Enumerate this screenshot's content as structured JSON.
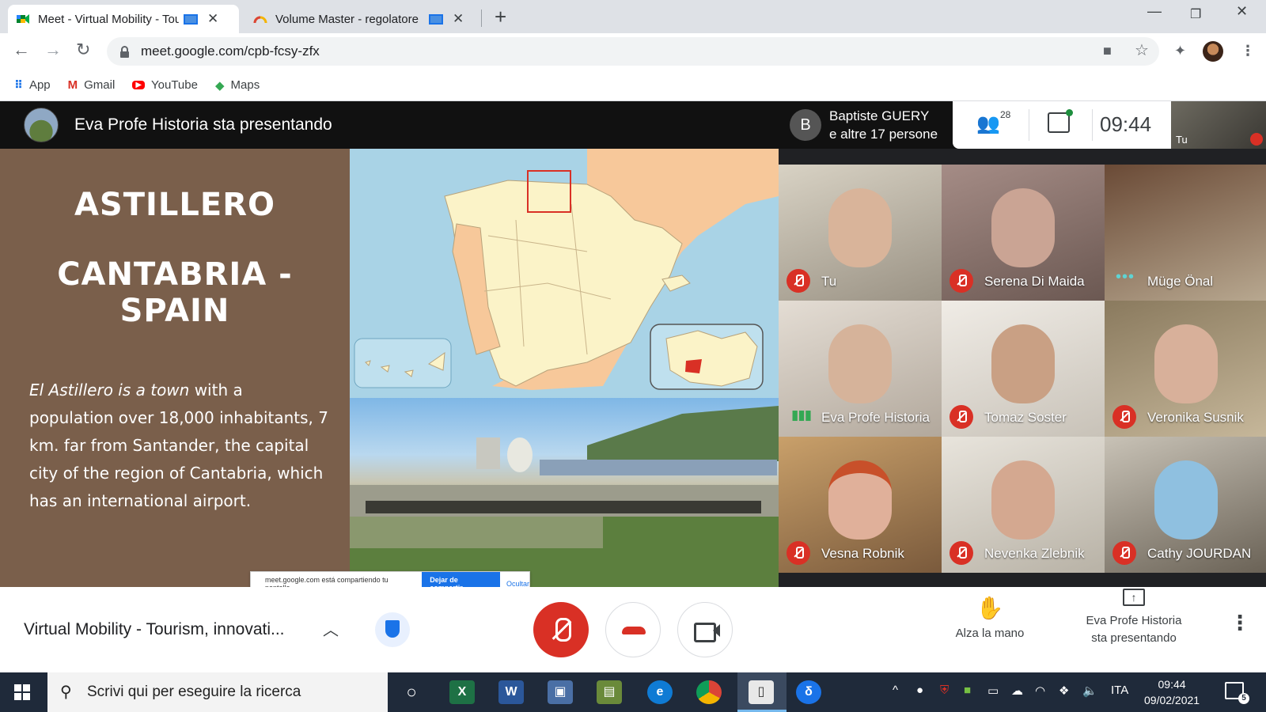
{
  "browser": {
    "tabs": [
      {
        "title": "Meet - Virtual Mobility - Tou",
        "favicon": "google-meet-icon",
        "active": true
      },
      {
        "title": "Volume Master - regolatore",
        "favicon": "volume-master-icon",
        "active": false
      }
    ],
    "url": "meet.google.com/cpb-fcsy-zfx",
    "bookmarks": [
      {
        "label": "App",
        "icon": "apps-grid-icon"
      },
      {
        "label": "Gmail",
        "icon": "gmail-icon"
      },
      {
        "label": "YouTube",
        "icon": "youtube-icon"
      },
      {
        "label": "Maps",
        "icon": "maps-icon"
      }
    ]
  },
  "meet": {
    "presenting_banner": "Eva Profe Historia sta presentando",
    "notification": {
      "avatar_letter": "B",
      "line1": "Baptiste GUERY",
      "line2": "e altre 17 persone"
    },
    "people_count": "28",
    "clock": "09:44",
    "self_label": "Tu",
    "slide": {
      "title1": "ASTILLERO",
      "title2_line1": "CANTABRIA -",
      "title2_line2": "SPAIN",
      "body_italic": "El Astillero is a town",
      "body_rest": " with a population over 18,000 inhabitants, 7 km. far from Santander, the capital city of the region of Cantabria, which has an international airport."
    },
    "share_banner": {
      "text": "meet.google.com está compartiendo tu pantalla.",
      "stop": "Dejar de compartir",
      "hide": "Ocultar"
    },
    "participants": [
      {
        "name": "Tu",
        "status": "muted"
      },
      {
        "name": "Serena Di Maida",
        "status": "muted"
      },
      {
        "name": "Müge Önal",
        "status": "dots"
      },
      {
        "name": "Eva Profe Historia",
        "status": "talking"
      },
      {
        "name": "Tomaz Soster",
        "status": "muted"
      },
      {
        "name": "Veronika Susnik",
        "status": "muted"
      },
      {
        "name": "Vesna Robnik",
        "status": "muted"
      },
      {
        "name": "Nevenka Zlebnik",
        "status": "muted"
      },
      {
        "name": "Cathy JOURDAN",
        "status": "muted"
      }
    ],
    "controls": {
      "meeting_title": "Virtual Mobility - Tourism, innovati...",
      "raise_hand": "Alza la mano",
      "presenting_line1": "Eva Profe Historia",
      "presenting_line2": "sta presentando"
    },
    "colors": {
      "mute_red": "#d93025",
      "accent_blue": "#1a73e8",
      "slide_brown": "#7a5f4b"
    }
  },
  "taskbar": {
    "search_placeholder": "Scrivi qui per eseguire la ricerca",
    "language": "ITA",
    "time": "09:44",
    "date": "09/02/2021",
    "notifications": "5"
  }
}
